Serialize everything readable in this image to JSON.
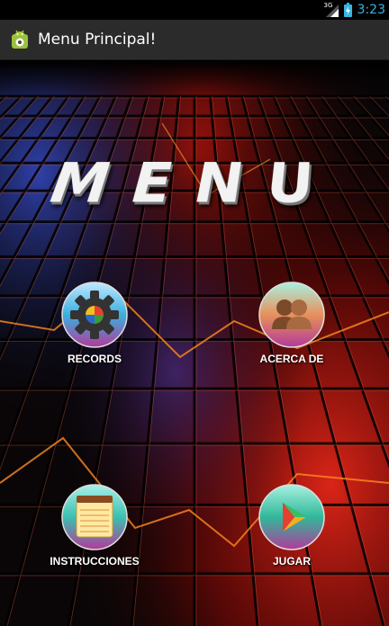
{
  "status_bar": {
    "network_type": "3G",
    "time": "3:23",
    "accent_color": "#35b5e5",
    "icons": [
      "signal-icon",
      "battery-icon"
    ]
  },
  "action_bar": {
    "title": "Menu Principal!",
    "icon": "android-icon"
  },
  "main": {
    "heading": "MENU",
    "buttons": [
      {
        "label": "RECORDS",
        "icon": "gear-icon"
      },
      {
        "label": "ACERCA DE",
        "icon": "users-icon"
      },
      {
        "label": "INSTRUCCIONES",
        "icon": "notepad-icon"
      },
      {
        "label": "JUGAR",
        "icon": "play-icon"
      }
    ]
  },
  "colors": {
    "action_bar_bg": "#2b2b2b",
    "background": "#000000",
    "glow_red": "#e0241b",
    "glow_blue": "#2a3fbf"
  }
}
